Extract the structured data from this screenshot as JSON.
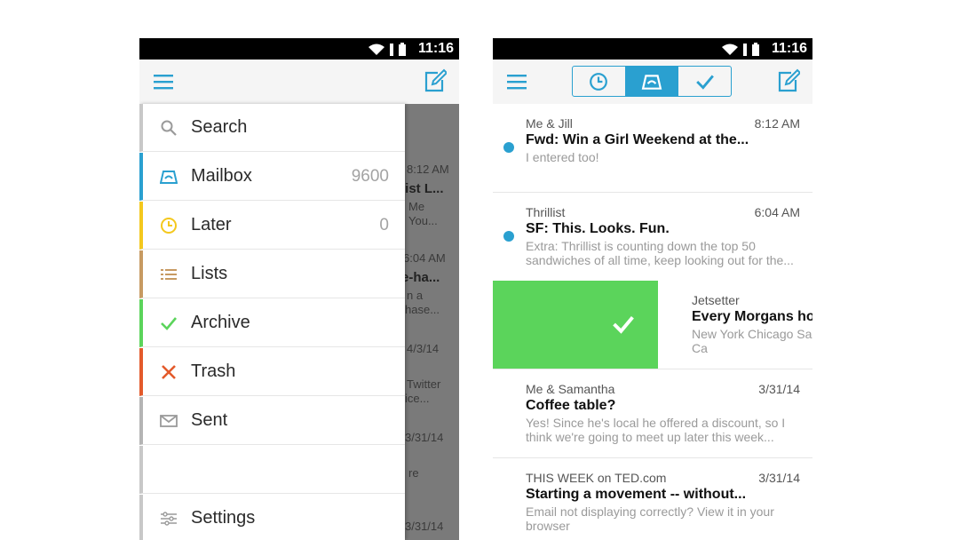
{
  "status_bar": {
    "time": "11:16"
  },
  "colors": {
    "accent": "#2aa0d0",
    "mailbox": "#2aa0d0",
    "later": "#f4c81e",
    "lists": "#c79a62",
    "archive": "#5bd45b",
    "trash": "#e35a2b",
    "sent": "#b4b4b4"
  },
  "left_screen": {
    "drawer_items": [
      {
        "label": "Search",
        "count": "",
        "icon": "search-icon"
      },
      {
        "label": "Mailbox",
        "count": "9600",
        "icon": "mailbox-icon"
      },
      {
        "label": "Later",
        "count": "0",
        "icon": "clock-icon"
      },
      {
        "label": "Lists",
        "count": "",
        "icon": "list-icon"
      },
      {
        "label": "Archive",
        "count": "",
        "icon": "check-icon"
      },
      {
        "label": "Trash",
        "count": "",
        "icon": "x-icon"
      },
      {
        "label": "Sent",
        "count": "",
        "icon": "envelope-icon"
      },
      {
        "label": "Settings",
        "count": "",
        "icon": "sliders-icon"
      }
    ],
    "behind_text": [
      "8:12 AM",
      "list L...",
      "Me",
      "You...",
      "6:04 AM",
      "e-ha...",
      "n a",
      "hase...",
      "4/3/14",
      "Twitter",
      "ice...",
      "3/31/14",
      "re",
      "3/31/14"
    ]
  },
  "right_screen": {
    "messages": [
      {
        "from": "Me & Jill",
        "time": "8:12 AM",
        "subject": "Fwd: Win a Girl Weekend at the...",
        "preview": "I entered too!",
        "unread": true
      },
      {
        "from": "Thrillist",
        "time": "6:04 AM",
        "subject": "SF: This. Looks. Fun.",
        "preview": "Extra: Thrillist is counting down the top 50 sandwiches of all time, keep looking out for the...",
        "unread": true
      },
      {
        "from": "Jetsetter",
        "time": "",
        "subject": "Every Morgans hot",
        "preview": "New York Chicago Sa Paris Los Angeles Ca",
        "unread": false
      },
      {
        "from": "Me & Samantha",
        "time": "3/31/14",
        "subject": "Coffee table?",
        "preview": "Yes! Since he's local he offered a discount, so I think we're going to meet up later this week...",
        "unread": false
      },
      {
        "from": "THIS WEEK on TED.com",
        "time": "3/31/14",
        "subject": "Starting a movement -- without...",
        "preview": "Email not displaying correctly? View it in your browser",
        "unread": false
      }
    ]
  }
}
